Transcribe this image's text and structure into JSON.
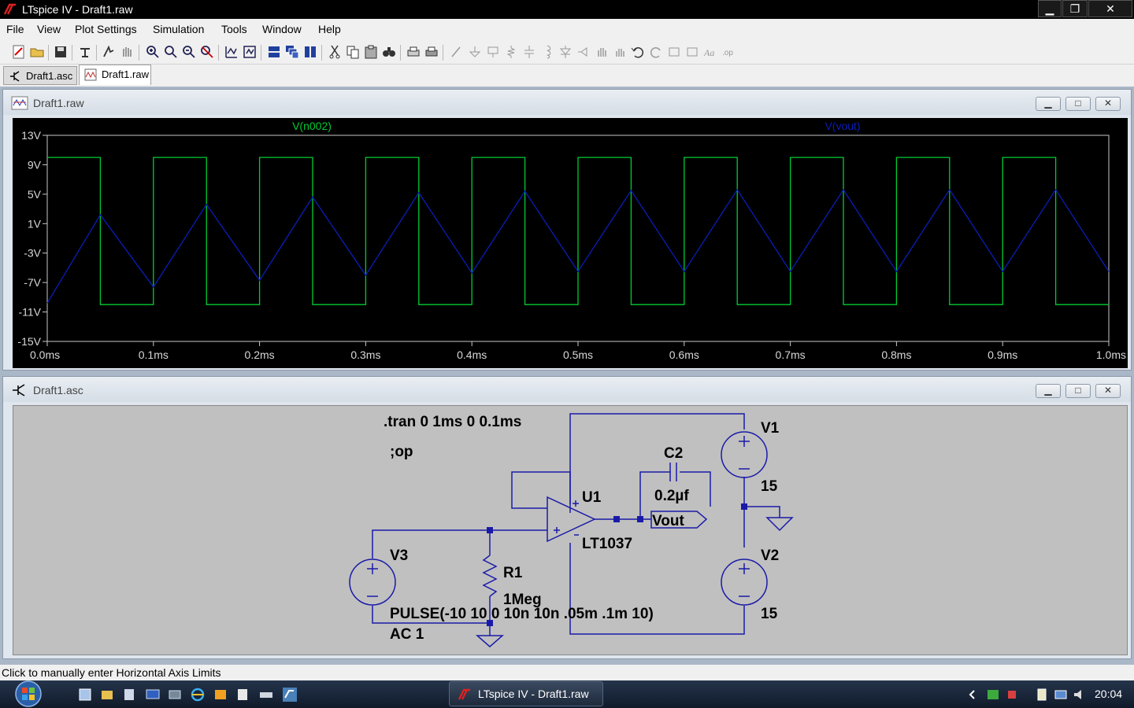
{
  "window": {
    "title": "LTspice IV - Draft1.raw",
    "minimize": "▁",
    "restore": "❐",
    "close": "✕"
  },
  "menu": [
    "File",
    "View",
    "Plot Settings",
    "Simulation",
    "Tools",
    "Window",
    "Help"
  ],
  "tabs": [
    {
      "label": "Draft1.asc",
      "active": false
    },
    {
      "label": "Draft1.raw",
      "active": true
    }
  ],
  "plot_window": {
    "title": "Draft1.raw",
    "traces": [
      {
        "name": "V(n002)",
        "color": "#00cc33"
      },
      {
        "name": "V(vout)",
        "color": "#0a1eb8"
      }
    ]
  },
  "chart_data": {
    "type": "line",
    "xlim": [
      0,
      1.0
    ],
    "ylim": [
      -15,
      13
    ],
    "x_ticks": [
      "0.0ms",
      "0.1ms",
      "0.2ms",
      "0.3ms",
      "0.4ms",
      "0.5ms",
      "0.6ms",
      "0.7ms",
      "0.8ms",
      "0.9ms",
      "1.0ms"
    ],
    "y_ticks": [
      "13V",
      "9V",
      "5V",
      "1V",
      "-3V",
      "-7V",
      "-11V",
      "-15V"
    ],
    "y_tick_values": [
      13,
      9,
      5,
      1,
      -3,
      -7,
      -11,
      -15
    ],
    "grid": false,
    "series": [
      {
        "name": "V(n002)",
        "x": [
          0,
          0.05,
          0.05,
          0.1,
          0.1,
          0.15,
          0.15,
          0.2,
          0.2,
          0.25,
          0.25,
          0.3,
          0.3,
          0.35,
          0.35,
          0.4,
          0.4,
          0.45,
          0.45,
          0.5,
          0.5,
          0.55,
          0.55,
          0.6,
          0.6,
          0.65,
          0.65,
          0.7,
          0.7,
          0.75,
          0.75,
          0.8,
          0.8,
          0.85,
          0.85,
          0.9,
          0.9,
          0.95,
          0.95,
          1.0
        ],
        "y": [
          10,
          10,
          -10,
          -10,
          10,
          10,
          -10,
          -10,
          10,
          10,
          -10,
          -10,
          10,
          10,
          -10,
          -10,
          10,
          10,
          -10,
          -10,
          10,
          10,
          -10,
          -10,
          10,
          10,
          -10,
          -10,
          10,
          10,
          -10,
          -10,
          10,
          10,
          -10,
          -10,
          10,
          10,
          -10,
          -10
        ]
      },
      {
        "name": "V(vout)",
        "x": [
          0,
          0.05,
          0.1,
          0.15,
          0.2,
          0.25,
          0.3,
          0.35,
          0.4,
          0.45,
          0.5,
          0.55,
          0.6,
          0.65,
          0.7,
          0.75,
          0.8,
          0.85,
          0.9,
          0.95,
          1.0
        ],
        "y": [
          -9.8,
          2.2,
          -7.6,
          3.6,
          -6.7,
          4.6,
          -6.0,
          5.2,
          -5.7,
          5.4,
          -5.5,
          5.5,
          -5.5,
          5.6,
          -5.5,
          5.6,
          -5.5,
          5.6,
          -5.5,
          5.6,
          -5.5
        ]
      }
    ]
  },
  "schematic_window": {
    "title": "Draft1.asc",
    "directive_tran": ".tran 0 1ms 0 0.1ms",
    "directive_op": ";op",
    "components": {
      "c2_name": "C2",
      "c2_value": "0.2µf",
      "u1_name": "U1",
      "u1_model": "LT1037",
      "r1_name": "R1",
      "r1_value": "1Meg",
      "v1_name": "V1",
      "v1_value": "15",
      "v2_name": "V2",
      "v2_value": "15",
      "v3_name": "V3",
      "v3_value": "PULSE(-10 10 0 10n 10n .05m .1m 10)",
      "v3_ac": "AC 1",
      "net_label": "Vout"
    }
  },
  "status": "Click to manually enter Horizontal Axis Limits",
  "taskbar": {
    "task_label": "LTspice IV - Draft1.raw",
    "clock": "20:04"
  }
}
